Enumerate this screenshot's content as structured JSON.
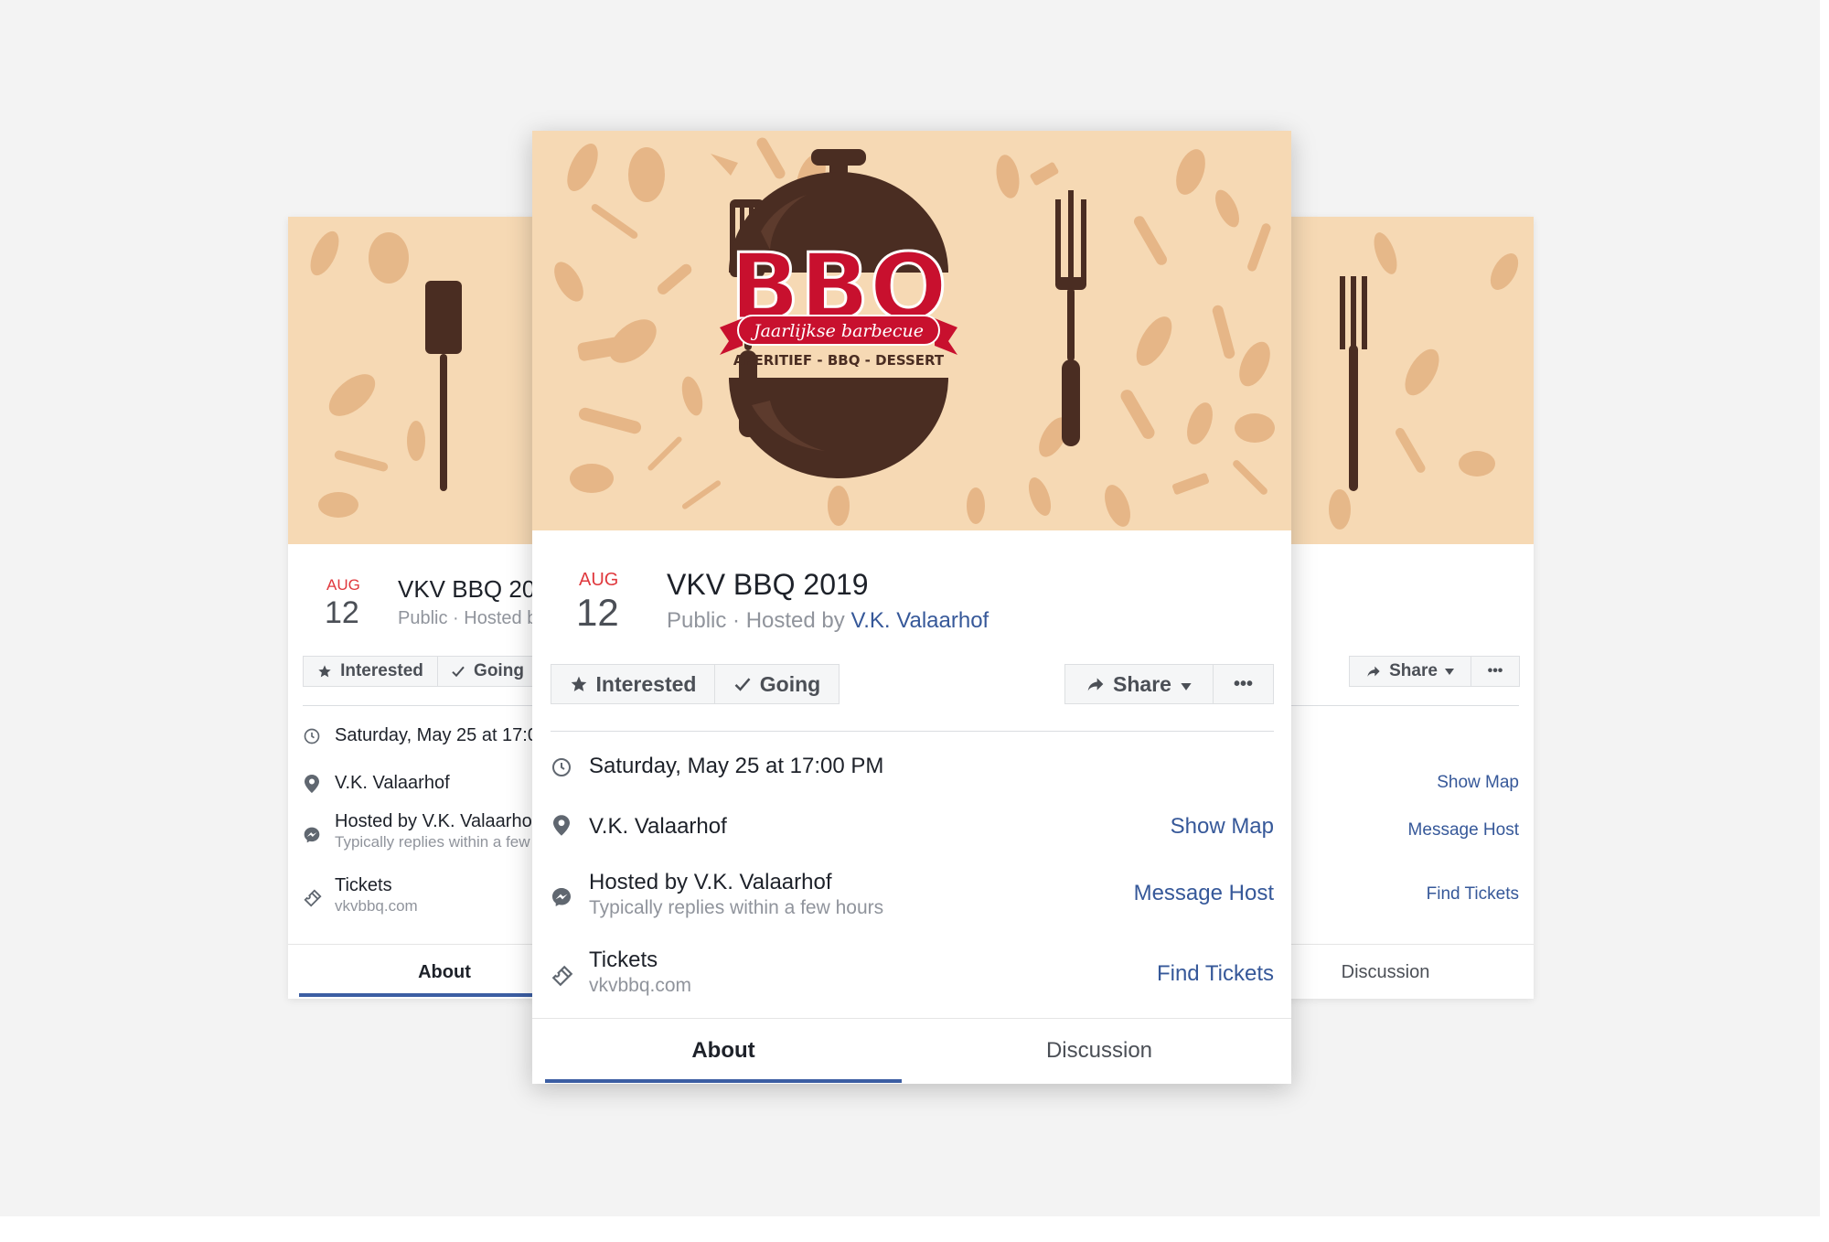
{
  "event": {
    "month": "AUG",
    "day": "12",
    "title": "VKV BBQ 2019",
    "visibility": "Public",
    "hosted_prefix": "· Hosted by",
    "host_name": "V.K. Valaarhof"
  },
  "cover": {
    "headline": "BBQ",
    "ribbon": "Jaarlijkse barbecue",
    "subline": "APERITIEF - BBQ - DESSERT"
  },
  "actions": {
    "interested": "Interested",
    "going": "Going",
    "share": "Share",
    "more": "•••"
  },
  "details": {
    "datetime": "Saturday, May 25 at 17:00 PM",
    "location": "V.K. Valaarhof",
    "show_map": "Show Map",
    "hosted_by": "Hosted by V.K. Valaarhof",
    "reply_time": "Typically replies within a few hours",
    "message_host": "Message Host",
    "tickets": "Tickets",
    "tickets_site": "vkvbbq.com",
    "find_tickets": "Find Tickets"
  },
  "tabs": {
    "about": "About",
    "discussion": "Discussion"
  },
  "colors": {
    "page_bg": "#f3f3f3",
    "cover_bg": "#f6d9b4",
    "grill": "#4a2d22",
    "brand_red": "#c8102e",
    "link_blue": "#365899",
    "tab_underline": "#3c5ea3",
    "date_red": "#e0393e"
  }
}
